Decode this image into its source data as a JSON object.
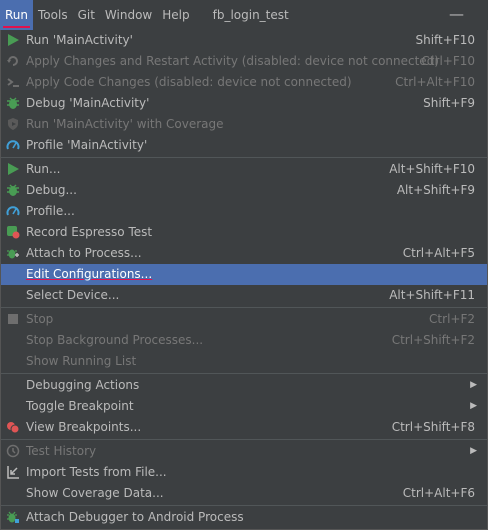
{
  "menubar": {
    "items": [
      "Run",
      "Tools",
      "Git",
      "Window",
      "Help"
    ],
    "project_title": "fb_login_test",
    "minimize_glyph": "—"
  },
  "menu": {
    "items": [
      {
        "label": "Run 'MainActivity'",
        "shortcut": "Shift+F10",
        "icon": "run-icon",
        "enabled": true
      },
      {
        "label": "Apply Changes and Restart Activity (disabled: device not connected)",
        "shortcut": "Ctrl+F10",
        "icon": "apply-changes-restart-icon",
        "enabled": false
      },
      {
        "label": "Apply Code Changes (disabled: device not connected)",
        "shortcut": "Ctrl+Alt+F10",
        "icon": "apply-code-changes-icon",
        "enabled": false
      },
      {
        "label": "Debug 'MainActivity'",
        "shortcut": "Shift+F9",
        "icon": "debug-icon",
        "enabled": true
      },
      {
        "label": "Run 'MainActivity' with Coverage",
        "shortcut": "",
        "icon": "coverage-icon",
        "enabled": false
      },
      {
        "label": "Profile 'MainActivity'",
        "shortcut": "",
        "icon": "profile-icon",
        "enabled": true
      },
      {
        "label": "Run...",
        "shortcut": "Alt+Shift+F10",
        "icon": "run-icon",
        "enabled": true
      },
      {
        "label": "Debug...",
        "shortcut": "Alt+Shift+F9",
        "icon": "debug-icon",
        "enabled": true
      },
      {
        "label": "Profile...",
        "shortcut": "",
        "icon": "profile-icon",
        "enabled": true
      },
      {
        "label": "Record Espresso Test",
        "shortcut": "",
        "icon": "record-espresso-icon",
        "enabled": true
      },
      {
        "label": "Attach to Process...",
        "shortcut": "Ctrl+Alt+F5",
        "icon": "attach-process-icon",
        "enabled": true
      },
      {
        "label": "Edit Configurations...",
        "shortcut": "",
        "icon": "",
        "enabled": true,
        "selected": true
      },
      {
        "label": "Select Device...",
        "shortcut": "Alt+Shift+F11",
        "icon": "",
        "enabled": true
      },
      {
        "label": "Stop",
        "shortcut": "Ctrl+F2",
        "icon": "stop-icon",
        "enabled": false
      },
      {
        "label": "Stop Background Processes...",
        "shortcut": "Ctrl+Shift+F2",
        "icon": "",
        "enabled": false
      },
      {
        "label": "Show Running List",
        "shortcut": "",
        "icon": "",
        "enabled": false
      },
      {
        "label": "Debugging Actions",
        "shortcut": "",
        "icon": "",
        "enabled": true,
        "submenu": true
      },
      {
        "label": "Toggle Breakpoint",
        "shortcut": "",
        "icon": "",
        "enabled": true,
        "submenu": true
      },
      {
        "label": "View Breakpoints...",
        "shortcut": "Ctrl+Shift+F8",
        "icon": "breakpoints-icon",
        "enabled": true
      },
      {
        "label": "Test History",
        "shortcut": "",
        "icon": "history-icon",
        "enabled": false,
        "submenu": true
      },
      {
        "label": "Import Tests from File...",
        "shortcut": "",
        "icon": "import-tests-icon",
        "enabled": true
      },
      {
        "label": "Show Coverage Data...",
        "shortcut": "Ctrl+Alt+F6",
        "icon": "",
        "enabled": true
      },
      {
        "label": "Attach Debugger to Android Process",
        "shortcut": "",
        "icon": "attach-debugger-icon",
        "enabled": true
      }
    ],
    "submenu_glyph": "▶"
  },
  "colors": {
    "background": "#3c3f41",
    "selection": "#4b6eaf",
    "accent_underline": "#e0124d",
    "run_green": "#499c54",
    "profile_blue": "#40a0d8"
  }
}
